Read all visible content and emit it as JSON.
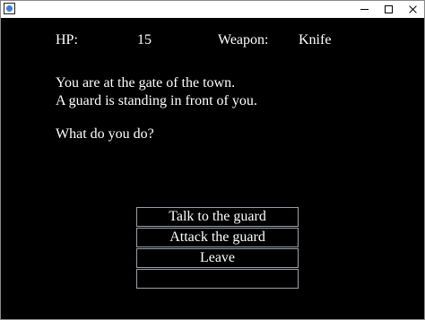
{
  "window": {
    "icons": {
      "app": "app-face-icon",
      "minimize": "minimize-icon",
      "maximize": "maximize-icon",
      "close": "close-icon"
    }
  },
  "hud": {
    "hp_label": "HP:",
    "hp_value": "15",
    "weapon_label": "Weapon:",
    "weapon_value": "Knife"
  },
  "story": {
    "line1": "You are at the gate of the town.",
    "line2": "A guard is standing in front of you.",
    "prompt": "What do you do?"
  },
  "choices": [
    {
      "label": "Talk to the guard"
    },
    {
      "label": "Attack the guard"
    },
    {
      "label": "Leave"
    },
    {
      "label": ""
    }
  ],
  "colors": {
    "background": "#000000",
    "text": "#ffffff",
    "button_border": "#9aa2a8",
    "icon_accent": "#3b7bd8"
  }
}
